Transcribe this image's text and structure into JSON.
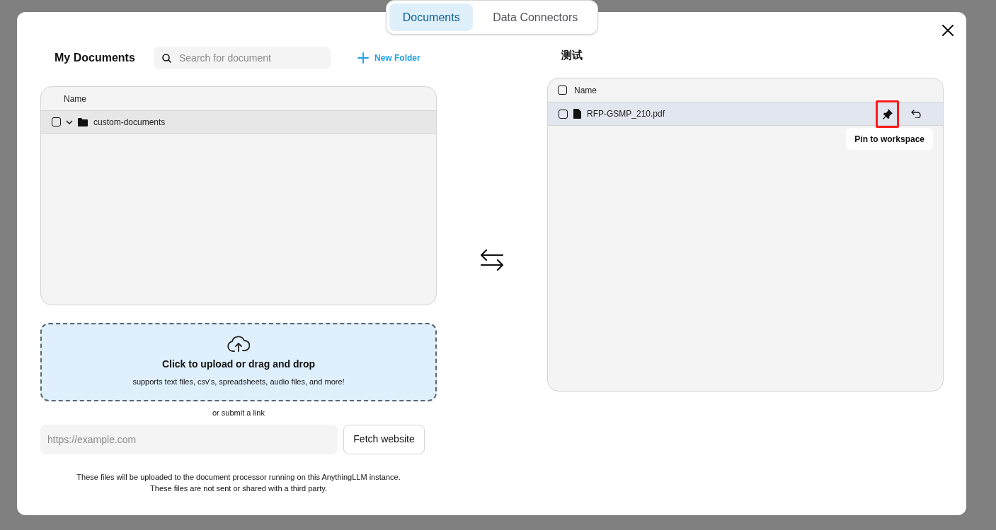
{
  "tabs": [
    {
      "label": "Documents",
      "selected": true
    },
    {
      "label": "Data Connectors",
      "selected": false
    }
  ],
  "my_documents": {
    "title": "My Documents",
    "search": {
      "placeholder": "Search for document"
    },
    "new_folder": "New Folder",
    "table": {
      "header": "Name",
      "rows": [
        {
          "name": "custom-documents",
          "kind": "folder",
          "checked": false,
          "expanded": true
        }
      ]
    }
  },
  "upload": {
    "title": "Click to upload or drag and drop",
    "subtitle": "supports text files, csv's, spreadsheets, audio files, and more!",
    "link_label": "or submit a link",
    "url": {
      "placeholder": "https://example.com"
    },
    "fetch_button": "Fetch website",
    "notice": [
      "These files will be uploaded to the document processor running on this AnythingLLM instance.",
      "These files are not sent or shared with a third party."
    ]
  },
  "workspace": {
    "title": "测试",
    "table": {
      "header": "Name",
      "header_checked": false,
      "rows": [
        {
          "name": "RFP-GSMP_210.pdf",
          "kind": "file",
          "checked": false,
          "pin_highlighted": true
        }
      ]
    },
    "tooltip": "Pin to workspace"
  }
}
